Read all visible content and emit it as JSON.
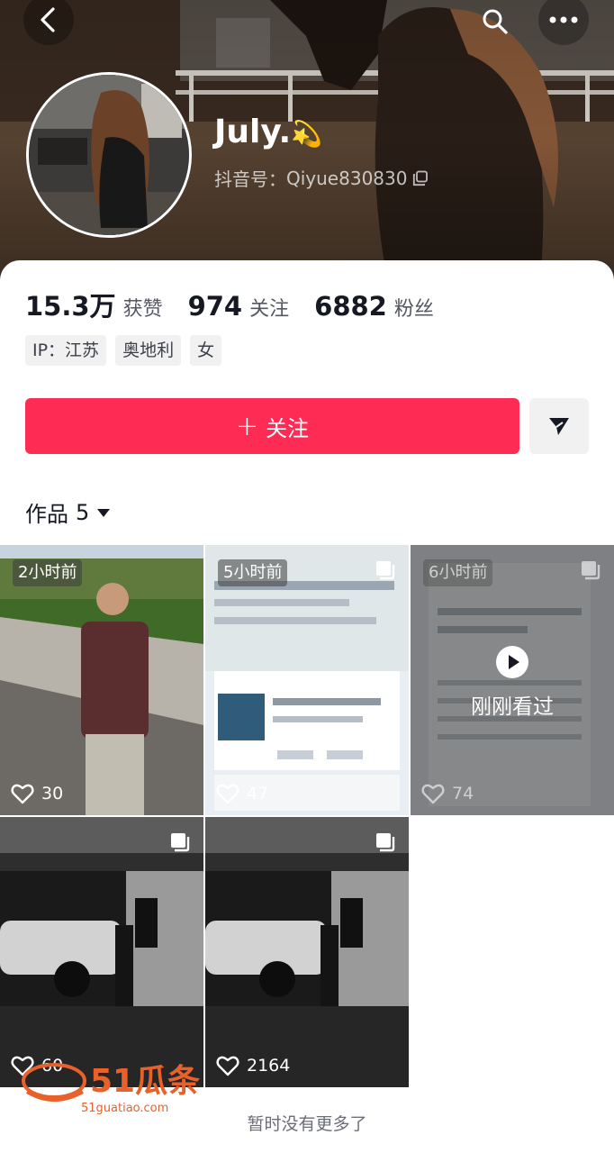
{
  "header": {
    "back_icon": "chevron-left-icon",
    "search_icon": "search-icon",
    "more_icon": "more-dots-icon",
    "nickname": "July.",
    "nickname_emoji": "💫",
    "douyin_id_label": "抖音号：",
    "douyin_id": "Qiyue830830",
    "copy_icon": "copy-icon"
  },
  "stats": [
    {
      "value": "15.3万",
      "label": "获赞"
    },
    {
      "value": "974",
      "label": "关注"
    },
    {
      "value": "6882",
      "label": "粉丝"
    }
  ],
  "tags": [
    "IP：江苏",
    "奥地利",
    "女"
  ],
  "actions": {
    "follow_plus": "+",
    "follow_label": "关注",
    "share_icon": "send-icon",
    "follow_color": "#fe2c55"
  },
  "works_tab": {
    "label": "作品",
    "count": "5",
    "dropdown_icon": "caret-down-icon"
  },
  "videos": [
    {
      "time": "2小时前",
      "likes": "30",
      "multi": false
    },
    {
      "time": "5小时前",
      "likes": "47",
      "multi": true
    },
    {
      "time": "6小时前",
      "likes": "74",
      "multi": true,
      "watched": "刚刚看过"
    },
    {
      "time": "",
      "likes": "60",
      "multi": true
    },
    {
      "time": "",
      "likes": "2164",
      "multi": true
    }
  ],
  "footer": {
    "no_more": "暂时没有更多了"
  },
  "watermark": {
    "brand": "51瓜条",
    "url": "51guatiao.com"
  }
}
